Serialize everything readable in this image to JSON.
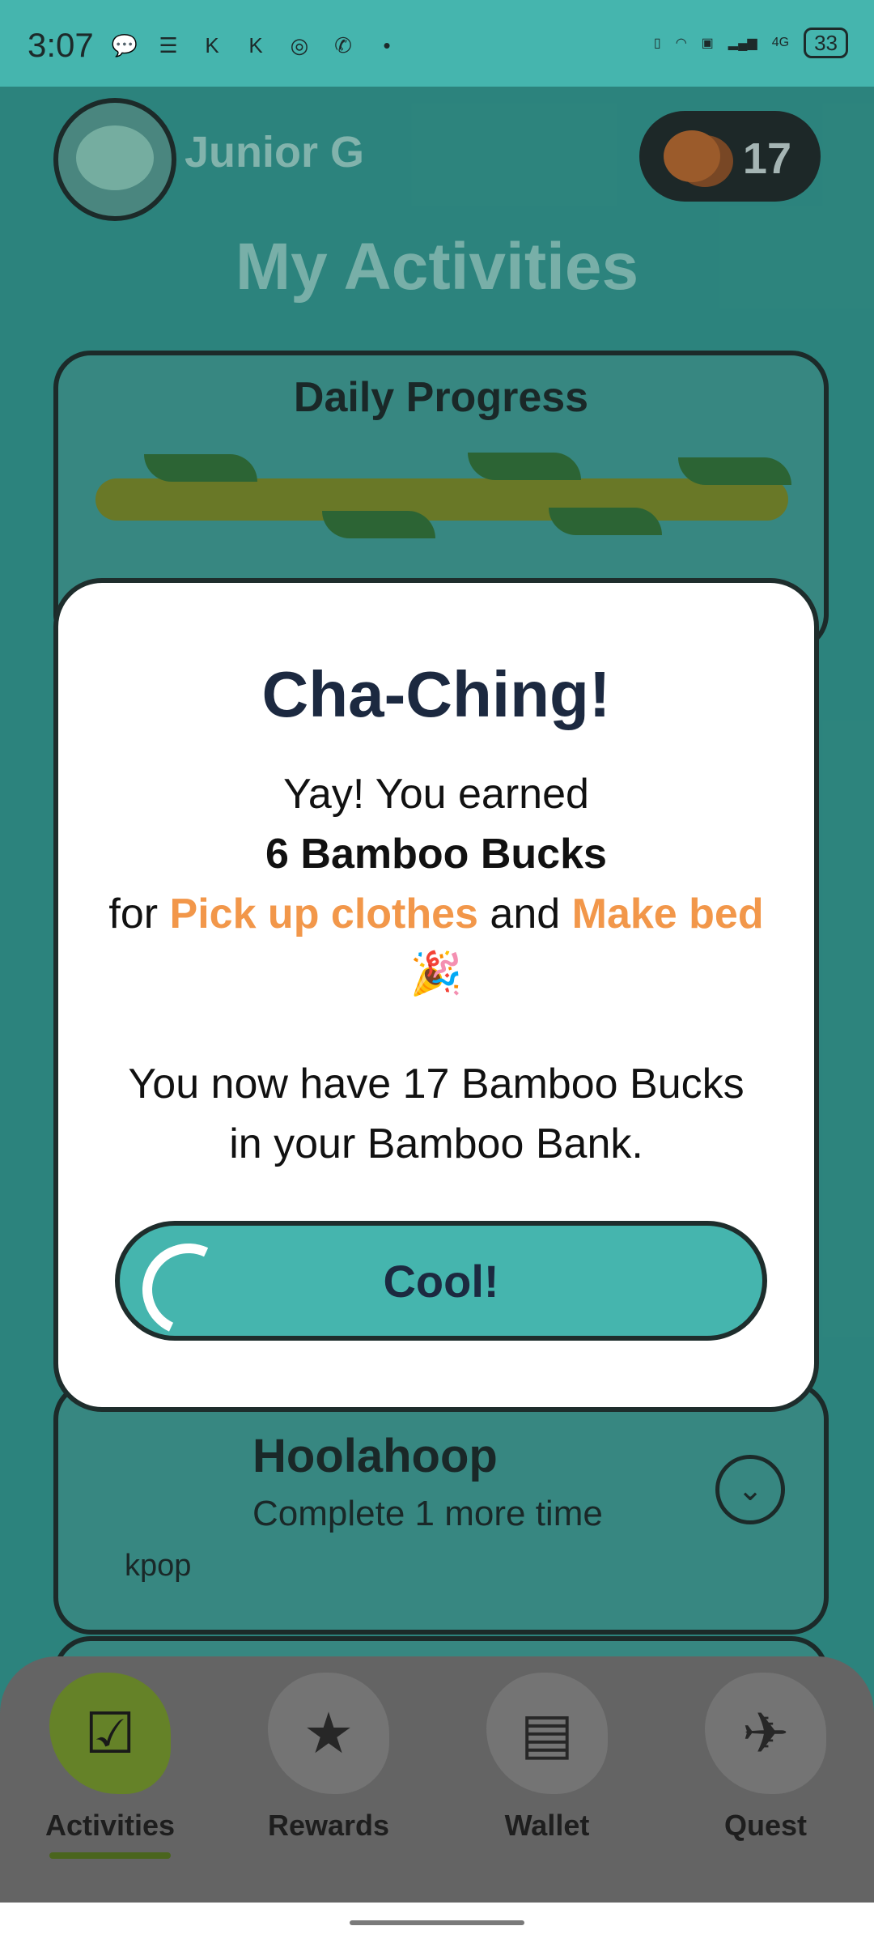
{
  "status_bar": {
    "time": "3:07",
    "network": "4G",
    "battery": "33"
  },
  "header": {
    "username": "Junior G",
    "coins": "17",
    "title": "My Activities"
  },
  "daily_progress": {
    "title": "Daily Progress"
  },
  "activity": {
    "name": "Hoolahoop",
    "subtitle": "Complete 1 more time",
    "tag": "kpop"
  },
  "modal": {
    "headline": "Cha-Ching!",
    "line1": "Yay! You earned",
    "reward": "6 Bamboo Bucks",
    "for_text": "for",
    "task1": "Pick up clothes",
    "and_text": "and",
    "task2": "Make bed",
    "emoji": "🎉",
    "balance_text": "You now have 17 Bamboo Bucks in your Bamboo Bank.",
    "button_label": "Cool!"
  },
  "nav": {
    "activities": "Activities",
    "rewards": "Rewards",
    "wallet": "Wallet",
    "quest": "Quest"
  }
}
